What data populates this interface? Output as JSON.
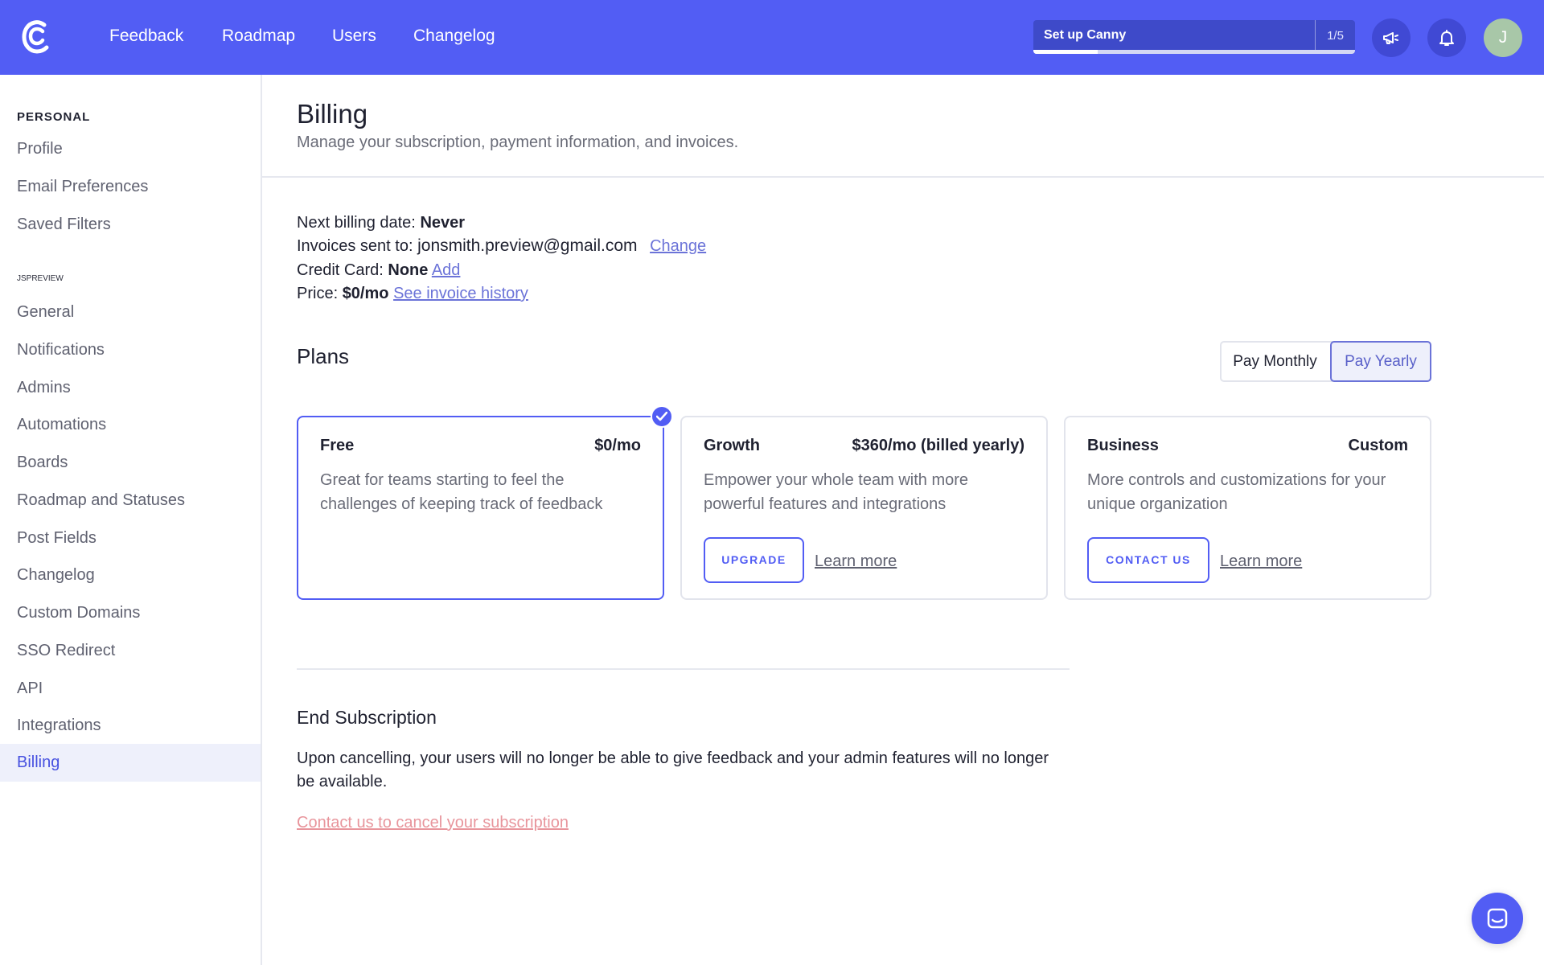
{
  "topbar": {
    "nav": [
      "Feedback",
      "Roadmap",
      "Users",
      "Changelog"
    ],
    "setup_label": "Set up Canny",
    "setup_count": "1/5",
    "setup_progress": 0.2,
    "avatar_initial": "J",
    "brand_color": "#525df4"
  },
  "sidebar": {
    "personal_heading": "PERSONAL",
    "personal_items": [
      "Profile",
      "Email Preferences",
      "Saved Filters"
    ],
    "company_heading": "JSPREVIEW",
    "company_items": [
      "General",
      "Notifications",
      "Admins",
      "Automations",
      "Boards",
      "Roadmap and Statuses",
      "Post Fields",
      "Changelog",
      "Custom Domains",
      "SSO Redirect",
      "API",
      "Integrations",
      "Billing"
    ],
    "active_item": "Billing"
  },
  "page": {
    "title": "Billing",
    "subtitle": "Manage your subscription, payment information, and invoices."
  },
  "billing": {
    "next_label": "Next billing date:",
    "next_value": "Never",
    "invoices_label": "Invoices sent to:",
    "invoices_value": "jonsmith.preview@gmail.com",
    "change_link": "Change",
    "card_label": "Credit Card:",
    "card_value": "None",
    "add_link": "Add",
    "price_label": "Price:",
    "price_value": "$0/mo",
    "history_link": "See invoice history"
  },
  "plans": {
    "title": "Plans",
    "pay_monthly": "Pay Monthly",
    "pay_yearly": "Pay Yearly",
    "selected_period": "Pay Yearly",
    "cards": [
      {
        "name": "Free",
        "price": "$0/mo",
        "desc": "Great for teams starting to feel the challenges of keeping track of feedback",
        "selected": true
      },
      {
        "name": "Growth",
        "price": "$360/mo (billed yearly)",
        "desc": "Empower your whole team with more powerful features and integrations",
        "button": "UPGRADE",
        "learn": "Learn more"
      },
      {
        "name": "Business",
        "price": "Custom",
        "desc": "More controls and customizations for your unique organization",
        "button": "CONTACT US",
        "learn": "Learn more"
      }
    ]
  },
  "end": {
    "title": "End Subscription",
    "text": "Upon cancelling, your users will no longer be able to give feedback and your admin features will no longer be available.",
    "cancel_link": "Contact us to cancel your subscription"
  }
}
